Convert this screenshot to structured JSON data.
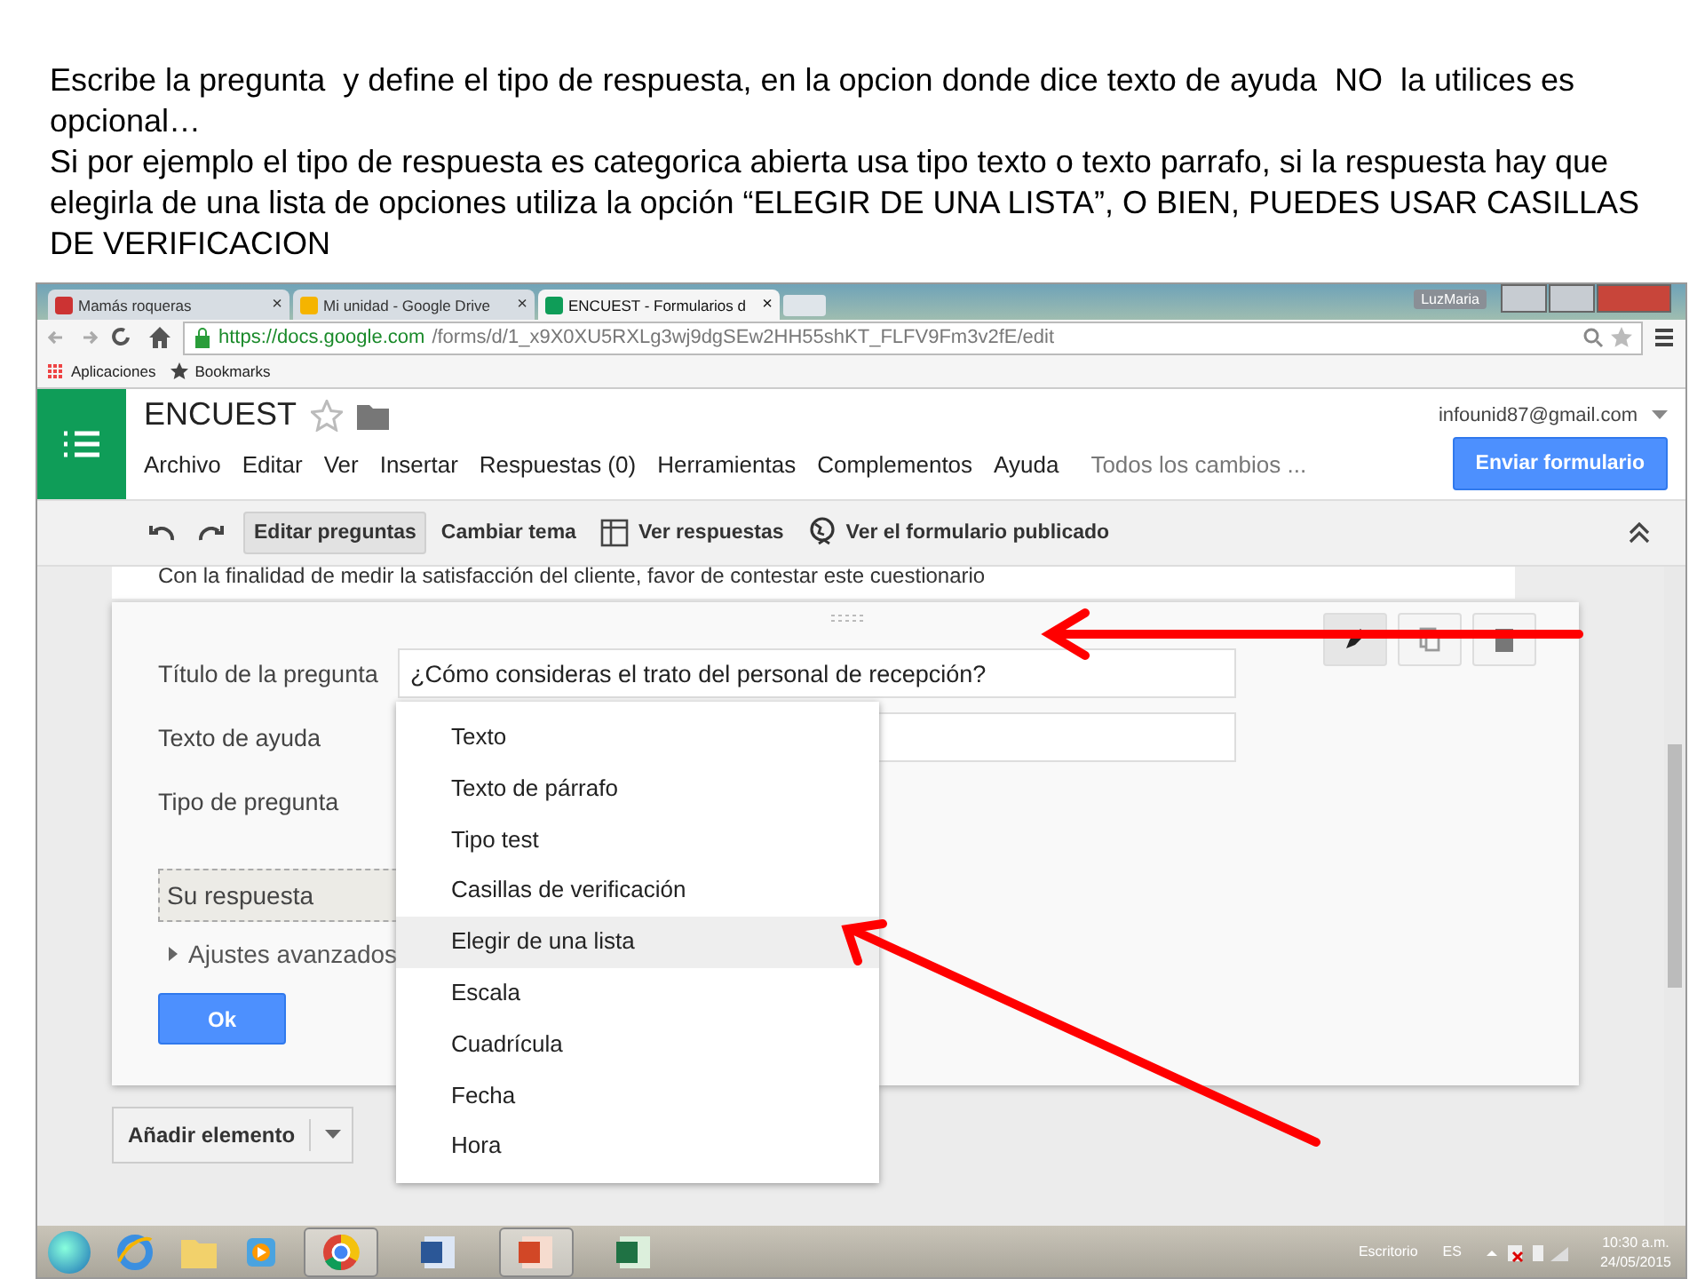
{
  "slide_text": [
    "Escribe la pregunta  y define el tipo de respuesta, en la opcion donde dice texto de ayuda  NO  la utilices es opcional…",
    "Si por ejemplo el tipo de respuesta es categorica abierta usa tipo texto o texto parrafo, si la respuesta hay que elegirla de una lista de opciones utiliza la opción “ELEGIR DE UNA LISTA”, O BIEN, PUEDES USAR CASILLAS DE VERIFICACION"
  ],
  "browser": {
    "tabs": [
      {
        "title": "Mamás roqueras",
        "selected": false,
        "close": "×"
      },
      {
        "title": "Mi unidad - Google Drive",
        "selected": false,
        "close": "×"
      },
      {
        "title": "ENCUEST - Formularios d",
        "selected": true,
        "close": "×"
      }
    ],
    "user": "LuzMaria",
    "url_host": "https://docs.google.com",
    "url_path": "/forms/d/1_x9X0XU5RXLg3wj9dgSEw2HH55shKT_FLFV9Fm3v2fE/edit",
    "bookmarks": [
      "Aplicaciones",
      "Bookmarks"
    ]
  },
  "doc": {
    "title": "ENCUEST",
    "account": "infounid87@gmail.com",
    "menu": [
      "Archivo",
      "Editar",
      "Ver",
      "Insertar",
      "Respuestas (0)",
      "Herramientas",
      "Complementos",
      "Ayuda"
    ],
    "save_status": "Todos los cambios ...",
    "send_button": "Enviar formulario"
  },
  "toolbar": [
    {
      "label": "Editar preguntas",
      "selected": true
    },
    {
      "label": "Cambiar tema",
      "selected": false
    },
    {
      "label": "Ver respuestas",
      "selected": false
    },
    {
      "label": "Ver el formulario publicado",
      "selected": false
    }
  ],
  "form_description": "Con la finalidad de medir la satisfacción del cliente, favor de contestar este cuestionario",
  "question": {
    "title_label": "Título de la pregunta",
    "title_value": "¿Cómo consideras el trato del personal de recepción?",
    "help_label": "Texto de ayuda",
    "type_label": "Tipo de pregunta",
    "answer_placeholder": "Su respuesta",
    "advanced": "Ajustes avanzados",
    "ok": "Ok"
  },
  "type_options": [
    {
      "label": "Texto",
      "selected": false
    },
    {
      "label": "Texto de párrafo",
      "selected": false
    },
    {
      "label": "Tipo test",
      "selected": false
    },
    {
      "label": "Casillas de verificación",
      "selected": false
    },
    {
      "label": "Elegir de una lista",
      "selected": true
    },
    {
      "label": "Escala",
      "selected": false
    },
    {
      "label": "Cuadrícula",
      "selected": false
    },
    {
      "label": "Fecha",
      "selected": false
    },
    {
      "label": "Hora",
      "selected": false
    }
  ],
  "add_item": "Añadir elemento",
  "taskbar": {
    "desktop": "Escritorio",
    "language": "ES",
    "time": "10:30 a.m.",
    "date": "24/05/2015"
  }
}
